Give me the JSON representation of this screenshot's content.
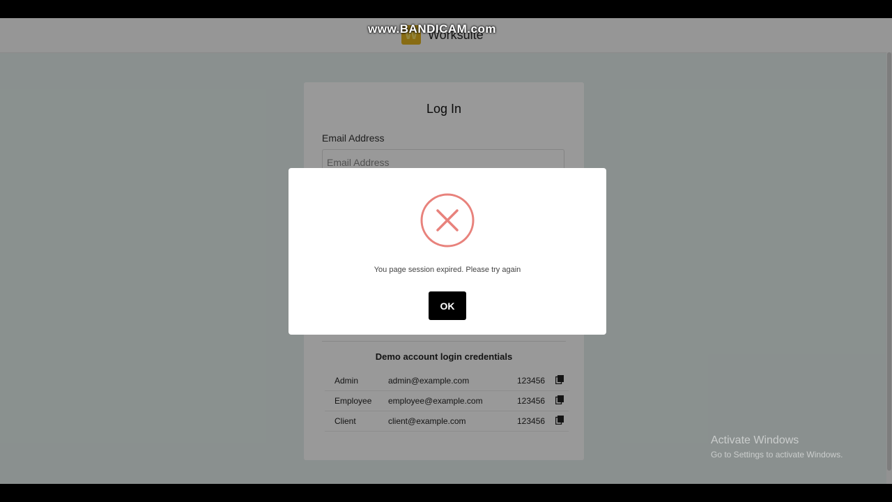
{
  "header": {
    "brand_logo_letter": "W",
    "brand_name": "Worksuite"
  },
  "login": {
    "title": "Log In",
    "email_label": "Email Address",
    "email_placeholder": "Email Address"
  },
  "demo": {
    "title": "Demo account login credentials",
    "rows": [
      {
        "role": "Admin",
        "email": "admin@example.com",
        "password": "123456"
      },
      {
        "role": "Employee",
        "email": "employee@example.com",
        "password": "123456"
      },
      {
        "role": "Client",
        "email": "client@example.com",
        "password": "123456"
      }
    ],
    "copy_icon": "copy-icon"
  },
  "modal": {
    "icon": "error-x-icon",
    "icon_color": "#e8827c",
    "message": "You page session expired. Please try again",
    "ok_label": "OK"
  },
  "watermarks": {
    "bandicam": "www.BANDICAM.com",
    "activate_title": "Activate Windows",
    "activate_sub": "Go to Settings to activate Windows."
  },
  "colors": {
    "brand_accent": "#e3b520",
    "page_bg": "#e6f1ef",
    "ok_button": "#000000"
  }
}
